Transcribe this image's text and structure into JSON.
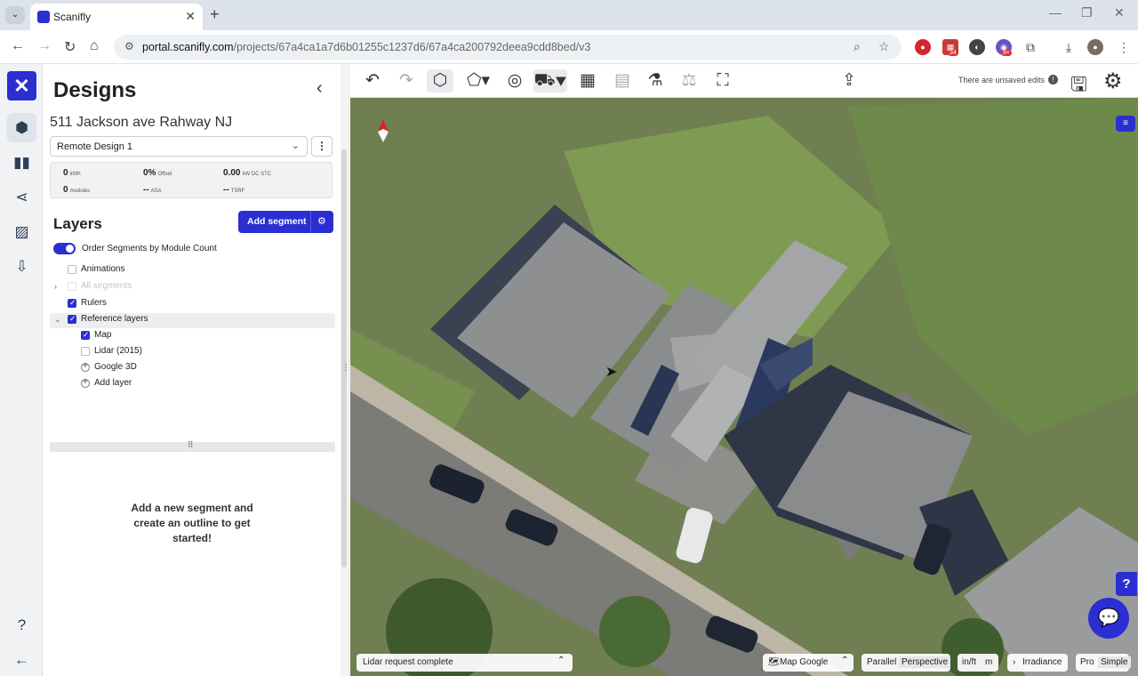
{
  "browser": {
    "tab_title": "Scanifly",
    "url_host": "portal.scanifly.com",
    "url_path": "/projects/67a4ca1a7d6b01255c1237d6/67a4ca200792deea9cdd8bed/v3",
    "extension_badges": [
      "34",
      "9+"
    ]
  },
  "sidebar_panel": {
    "title": "Designs",
    "project_name": "511 Jackson ave Rahway NJ",
    "design_select": "Remote Design 1",
    "stats": {
      "kwh_value": "0",
      "kwh_unit": "kWh",
      "offset_value": "0%",
      "offset_unit": "Offset",
      "kw_value": "0.00",
      "kw_unit": "kW DC STC",
      "modules_value": "0",
      "modules_unit": "modules",
      "asa_value": "--",
      "asa_unit": "ASA",
      "tsrf_value": "--",
      "tsrf_unit": "TSRF"
    },
    "layers_title": "Layers",
    "add_segment_label": "Add segment",
    "layers": {
      "order_segments": "Order Segments by Module Count",
      "animations": "Animations",
      "all_segments": "All segments",
      "rulers": "Rulers",
      "reference_layers": "Reference layers",
      "map": "Map",
      "lidar": "Lidar (2015)",
      "google3d": "Google 3D",
      "add_layer": "Add layer"
    },
    "empty_message": "Add a new segment and create an outline to get started!"
  },
  "toolbar": {
    "unsaved_text": "There are unsaved edits"
  },
  "map_controls": {
    "status_text": "Lidar request complete",
    "map_source": "Map Google",
    "view_parallel": "Parallel",
    "view_perspective": "Perspective",
    "unit_inft": "in/ft",
    "unit_m": "m",
    "irradiance": "Irradiance",
    "mode_pro": "Pro",
    "mode_simple": "Simple",
    "help": "?"
  },
  "colors": {
    "brand": "#2b2fd1",
    "roof_gray": "#8c8c8c",
    "grass": "#6f7f52"
  }
}
